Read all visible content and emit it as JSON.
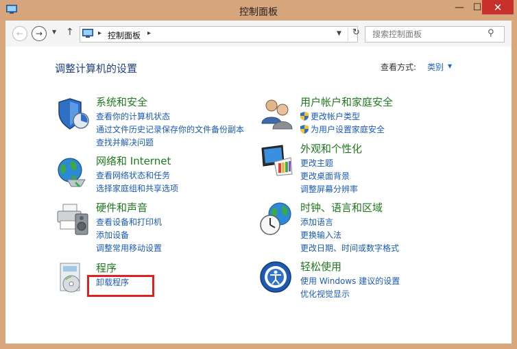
{
  "window": {
    "title": "控制面板",
    "minimize": "—",
    "maximize": "☐",
    "close": "✕"
  },
  "nav": {
    "back": "←",
    "forward": "→",
    "recent": "▼",
    "up": "↑",
    "breadcrumb_sep1": "▸",
    "breadcrumb": "控制面板",
    "breadcrumb_sep2": "▸",
    "address_dropdown": "▼",
    "refresh": "↻",
    "search_placeholder": "搜索控制面板",
    "search_icon": "⚲"
  },
  "main": {
    "heading": "调整计算机的设置",
    "view_by_label": "查看方式:",
    "view_by_value": "类别",
    "view_by_caret": "▼"
  },
  "categories": [
    {
      "title": "系统和安全",
      "icon": "shield-icon",
      "links": [
        "查看你的计算机状态",
        "通过文件历史记录保存你的文件备份副本",
        "查找并解决问题"
      ]
    },
    {
      "title": "网络和 Internet",
      "icon": "network-globe-icon",
      "links": [
        "查看网络状态和任务",
        "选择家庭组和共享选项"
      ]
    },
    {
      "title": "硬件和声音",
      "icon": "printer-speaker-icon",
      "links": [
        "查看设备和打印机",
        "添加设备",
        "调整常用移动设置"
      ]
    },
    {
      "title": "程序",
      "icon": "programs-disc-icon",
      "links": [
        "卸载程序"
      ]
    },
    {
      "title": "用户帐户和家庭安全",
      "icon": "users-icon",
      "links": [
        "更改帐户类型",
        "为用户设置家庭安全"
      ]
    },
    {
      "title": "外观和个性化",
      "icon": "monitor-palette-icon",
      "links": [
        "更改主题",
        "更改桌面背景",
        "调整屏幕分辨率"
      ]
    },
    {
      "title": "时钟、语言和区域",
      "icon": "clock-globe-icon",
      "links": [
        "添加语言",
        "更换输入法",
        "更改日期、时间或数字格式"
      ]
    },
    {
      "title": "轻松使用",
      "icon": "ease-of-access-icon",
      "links": [
        "使用 Windows 建议的设置",
        "优化视觉显示"
      ]
    }
  ],
  "colors": {
    "frame": "#d9a77c",
    "close_button": "#c9302c",
    "heading": "#1f3f83",
    "category_title": "#1d7a1d",
    "link": "#1a5ab8",
    "highlight_box": "#e02020"
  }
}
